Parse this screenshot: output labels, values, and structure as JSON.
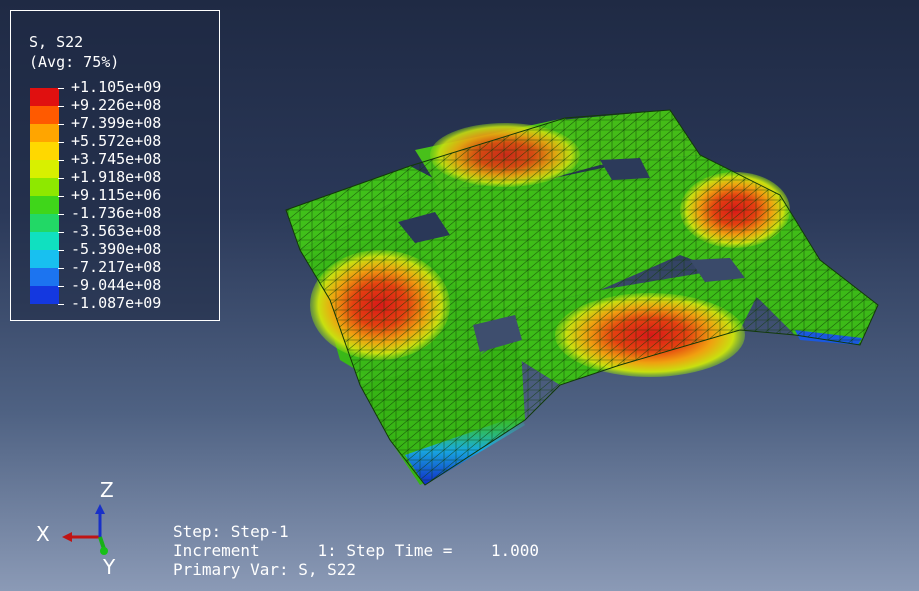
{
  "legend": {
    "title": "S, S22",
    "subtitle": "(Avg: 75%)",
    "levels": [
      "+1.105e+09",
      "+9.226e+08",
      "+7.399e+08",
      "+5.572e+08",
      "+3.745e+08",
      "+1.918e+08",
      "+9.115e+06",
      "-1.736e+08",
      "-3.563e+08",
      "-5.390e+08",
      "-7.217e+08",
      "-9.044e+08",
      "-1.087e+09"
    ],
    "colors": [
      "#e01010",
      "#ff5a00",
      "#ffa500",
      "#ffd800",
      "#d8f000",
      "#8ee800",
      "#3fd61a",
      "#22d866",
      "#10e0c0",
      "#18c0f0",
      "#1c74f0",
      "#1438e0",
      "#0818d8"
    ]
  },
  "triad": {
    "x": "X",
    "y": "Y",
    "z": "Z"
  },
  "status": {
    "step": "Step: Step-1",
    "increment_label": "Increment",
    "increment_value": "1: Step Time =",
    "step_time": "1.000",
    "primary_var": "Primary Var: S, S22"
  },
  "model": {
    "base_color": "#36b414",
    "mesh_color": "#0f3a05"
  }
}
